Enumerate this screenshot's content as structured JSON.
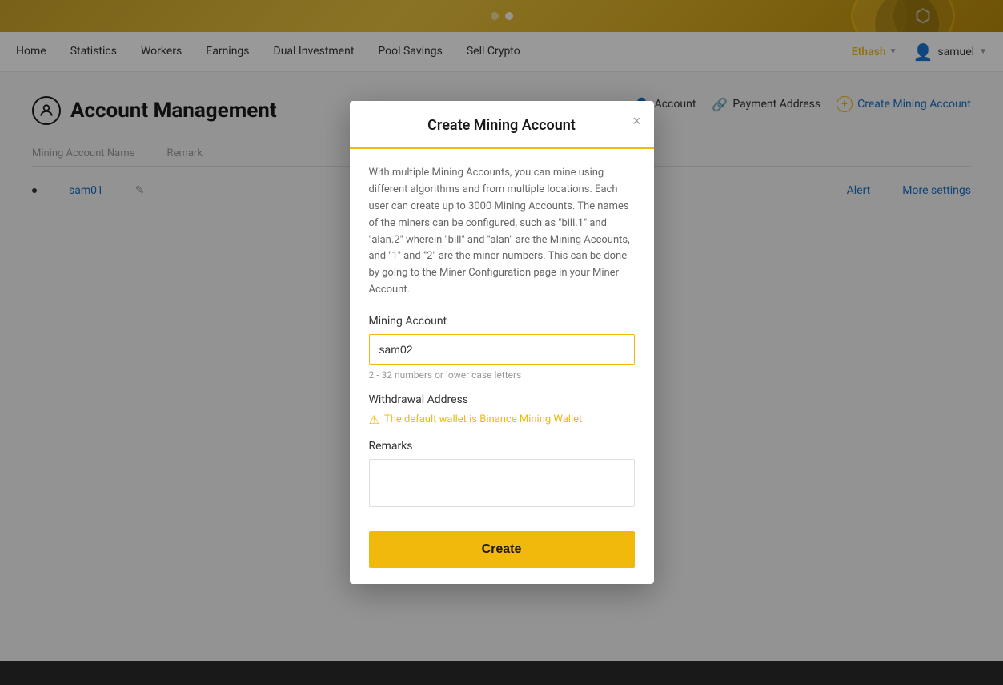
{
  "banner": {
    "visible": true
  },
  "nav": {
    "items": [
      {
        "label": "Home",
        "active": false
      },
      {
        "label": "Statistics",
        "active": false
      },
      {
        "label": "Workers",
        "active": false
      },
      {
        "label": "Earnings",
        "active": false
      },
      {
        "label": "Dual Investment",
        "active": false
      },
      {
        "label": "Pool Savings",
        "active": false
      },
      {
        "label": "Sell Crypto",
        "active": false
      }
    ],
    "ethash_label": "Ethash",
    "user_label": "samuel"
  },
  "page": {
    "title": "Account Management",
    "actions": {
      "account_btn": "Account",
      "payment_address_btn": "Payment Address",
      "create_mining_btn": "Create Mining Account"
    }
  },
  "table": {
    "headers": [
      "Mining Account Name",
      "Remark"
    ],
    "rows": [
      {
        "name": "sam01",
        "remark": "",
        "alert": "Alert",
        "more_settings": "More settings"
      }
    ]
  },
  "modal": {
    "title": "Create Mining Account",
    "close_label": "×",
    "description": "With multiple Mining Accounts, you can mine using different algorithms and from multiple locations. Each user can create up to 3000 Mining Accounts. The names of the miners can be configured, such as \"bill.1\" and \"alan.2\" wherein \"bill\" and \"alan\" are the Mining Accounts, and \"1\" and \"2\" are the miner numbers. This can be done by going to the Miner Configuration page in your Miner Account.",
    "mining_account_label": "Mining Account",
    "mining_account_value": "sam02",
    "mining_account_hint": "2 - 32 numbers or lower case letters",
    "withdrawal_label": "Withdrawal Address",
    "withdrawal_warning": "The default wallet is Binance Mining Wallet",
    "remarks_label": "Remarks",
    "remarks_placeholder": "",
    "create_button": "Create"
  }
}
